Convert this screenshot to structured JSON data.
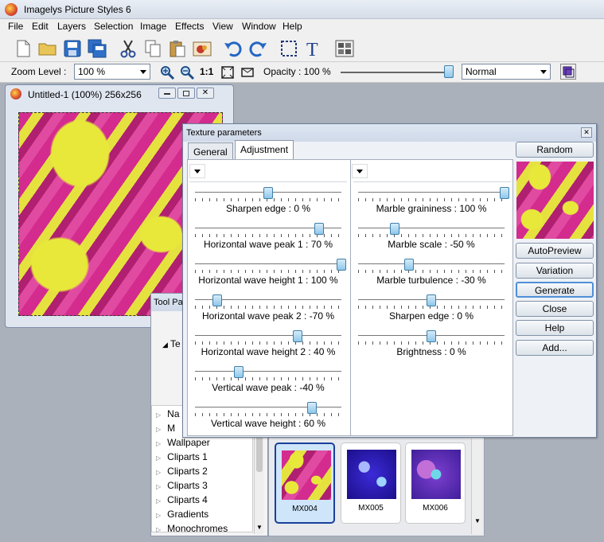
{
  "app": {
    "title": "Imagelys Picture Styles 6"
  },
  "menu": [
    "File",
    "Edit",
    "Layers",
    "Selection",
    "Image",
    "Effects",
    "View",
    "Window",
    "Help"
  ],
  "options": {
    "zoom_label": "Zoom Level :",
    "zoom_value": "100 %",
    "one_to_one": "1:1",
    "opacity_label": "Opacity : 100 %",
    "opacity_value": 1.0,
    "blend_mode": "Normal"
  },
  "document": {
    "title": "Untitled-1 (100%) 256x256"
  },
  "tool_palette": {
    "title": "Tool Pale",
    "tree_partial": "Te",
    "categories": [
      "Na",
      "M",
      "Wallpaper",
      "Cliparts 1",
      "Cliparts 2",
      "Cliparts 3",
      "Cliparts 4",
      "Gradients",
      "Monochromes"
    ],
    "thumbnails": [
      {
        "label": "MX004",
        "selected": true
      },
      {
        "label": "MX005",
        "selected": false
      },
      {
        "label": "MX006",
        "selected": false
      }
    ]
  },
  "dialog": {
    "title": "Texture parameters",
    "tabs": [
      "General",
      "Adjustment"
    ],
    "active_tab": "Adjustment",
    "left_sliders": [
      {
        "label": "Sharpen edge : 0 %",
        "fraction": 0.5
      },
      {
        "label": "Horizontal wave peak 1 : 70 %",
        "fraction": 0.85
      },
      {
        "label": "Horizontal wave height 1 : 100 %",
        "fraction": 1.0
      },
      {
        "label": "Horizontal wave peak 2 : -70 %",
        "fraction": 0.15
      },
      {
        "label": "Horizontal wave height 2 : 40 %",
        "fraction": 0.7
      },
      {
        "label": "Vertical wave peak : -40 %",
        "fraction": 0.3
      },
      {
        "label": "Vertical wave height : 60 %",
        "fraction": 0.8
      }
    ],
    "right_sliders": [
      {
        "label": "Marble graininess : 100 %",
        "fraction": 1.0
      },
      {
        "label": "Marble scale : -50 %",
        "fraction": 0.25
      },
      {
        "label": "Marble turbulence : -30 %",
        "fraction": 0.35
      },
      {
        "label": "Sharpen edge : 0 %",
        "fraction": 0.5
      },
      {
        "label": "Brightness : 0 %",
        "fraction": 0.5
      }
    ],
    "buttons": [
      "Random",
      "AutoPreview",
      "Variation",
      "Generate",
      "Close",
      "Help",
      "Add..."
    ],
    "default_button": "Generate"
  }
}
